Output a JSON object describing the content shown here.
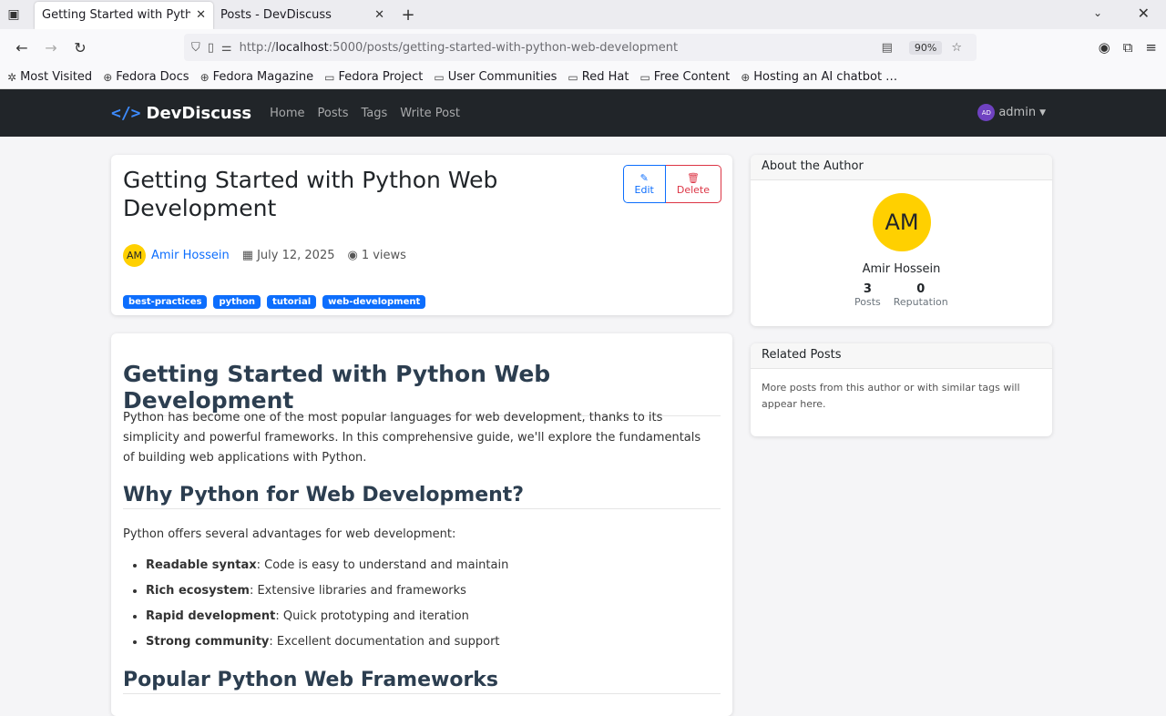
{
  "browser": {
    "tabs": [
      {
        "title": "Getting Started with Python \\",
        "active": true
      },
      {
        "title": "Posts - DevDiscuss",
        "active": false
      }
    ],
    "url_prefix": "http://",
    "url_host": "localhost",
    "url_rest": ":5000/posts/getting-started-with-python-web-development",
    "zoom": "90%",
    "bookmarks": [
      "Most Visited",
      "Fedora Docs",
      "Fedora Magazine",
      "Fedora Project",
      "User Communities",
      "Red Hat",
      "Free Content",
      "Hosting an AI chatbot …"
    ]
  },
  "site": {
    "brand": "DevDiscuss",
    "nav": [
      "Home",
      "Posts",
      "Tags",
      "Write Post"
    ],
    "user_initials": "AD",
    "user": "admin"
  },
  "post": {
    "title": "Getting Started with Python Web Development",
    "author_initials": "AM",
    "author": "Amir Hossein",
    "date": "July 12, 2025",
    "views": "1 views",
    "tags": [
      "best-practices",
      "python",
      "tutorial",
      "web-development"
    ],
    "edit_label": "Edit",
    "delete_label": "Delete"
  },
  "content": {
    "h1": "Getting Started with Python Web Development",
    "intro": "Python has become one of the most popular languages for web development, thanks to its simplicity and powerful frameworks. In this comprehensive guide, we'll explore the fundamentals of building web applications with Python.",
    "h2a": "Why Python for Web Development?",
    "p2": "Python offers several advantages for web development:",
    "list": [
      {
        "b": "Readable syntax",
        "t": ": Code is easy to understand and maintain"
      },
      {
        "b": "Rich ecosystem",
        "t": ": Extensive libraries and frameworks"
      },
      {
        "b": "Rapid development",
        "t": ": Quick prototyping and iteration"
      },
      {
        "b": "Strong community",
        "t": ": Excellent documentation and support"
      }
    ],
    "h2b": "Popular Python Web Frameworks"
  },
  "sidebar": {
    "about_title": "About the Author",
    "initials": "AM",
    "name": "Amir Hossein",
    "posts_count": "3",
    "posts_label": "Posts",
    "rep_count": "0",
    "rep_label": "Reputation",
    "related_title": "Related Posts",
    "related_text": "More posts from this author or with similar tags will appear here."
  }
}
